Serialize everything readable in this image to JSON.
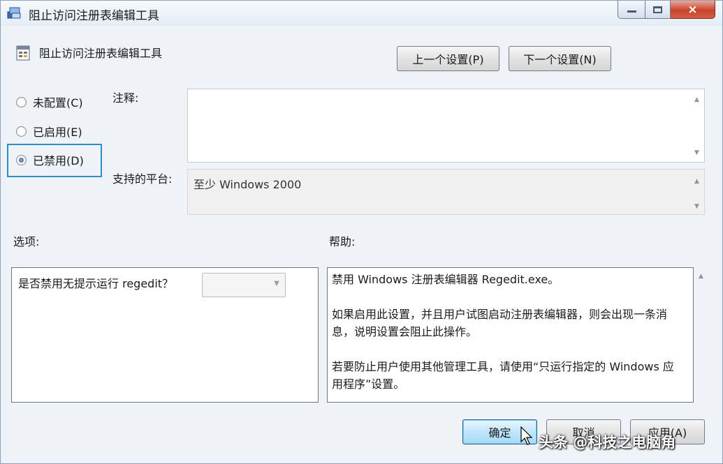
{
  "window": {
    "title": "阻止访问注册表编辑工具",
    "icon": "regedit-icon",
    "controls": {
      "minimize": "minimize-icon",
      "maximize": "maximize-icon",
      "close": "×"
    }
  },
  "header": {
    "policy_name": "阻止访问注册表编辑工具",
    "policy_icon": "policy-setting-icon",
    "prev_button": "上一个设置(P)",
    "next_button": "下一个设置(N)"
  },
  "state": {
    "options": [
      {
        "label": "未配置(C)",
        "checked": false
      },
      {
        "label": "已启用(E)",
        "checked": false
      },
      {
        "label": "已禁用(D)",
        "checked": true
      }
    ]
  },
  "comment": {
    "label": "注释:",
    "value": ""
  },
  "platform": {
    "label": "支持的平台:",
    "value": "至少 Windows 2000"
  },
  "options_pane": {
    "label": "选项:",
    "item_label": "是否禁用无提示运行 regedit？",
    "combo_value": ""
  },
  "help_pane": {
    "label": "帮助:",
    "paragraphs": [
      "禁用 Windows 注册表编辑器 Regedit.exe。",
      "如果启用此设置，并且用户试图启动注册表编辑器，则会出现一条消息，说明设置会阻止此操作。",
      "若要防止用户使用其他管理工具，请使用“只运行指定的 Windows 应用程序”设置。"
    ]
  },
  "footer": {
    "ok": "确定",
    "cancel": "取消",
    "apply": "应用(A)"
  },
  "watermark": "头条 @科技之电脑角",
  "colors": {
    "focus": "#2e8fc2",
    "window_bg": "#eff3f8",
    "close_button": "#c8432c"
  }
}
